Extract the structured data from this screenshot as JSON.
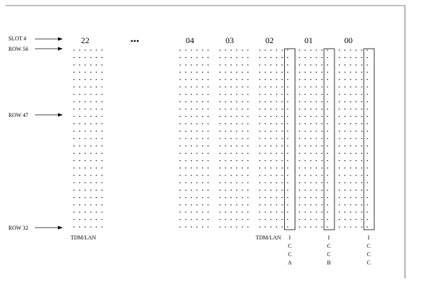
{
  "row_labels": {
    "slot": "SLOT #",
    "row56": "ROW 56",
    "row47": "ROW 47",
    "row32": "ROW 32"
  },
  "slots": [
    "22",
    "•••",
    "04",
    "03",
    "02",
    "01",
    "00"
  ],
  "bottom_labels": {
    "left": "TDM/LAN",
    "right": "TDM/LAN"
  },
  "icc": [
    [
      "I",
      "C",
      "C",
      "A"
    ],
    [
      "I",
      "C",
      "C",
      "B"
    ],
    [
      "I",
      "C",
      "C",
      "C"
    ]
  ]
}
